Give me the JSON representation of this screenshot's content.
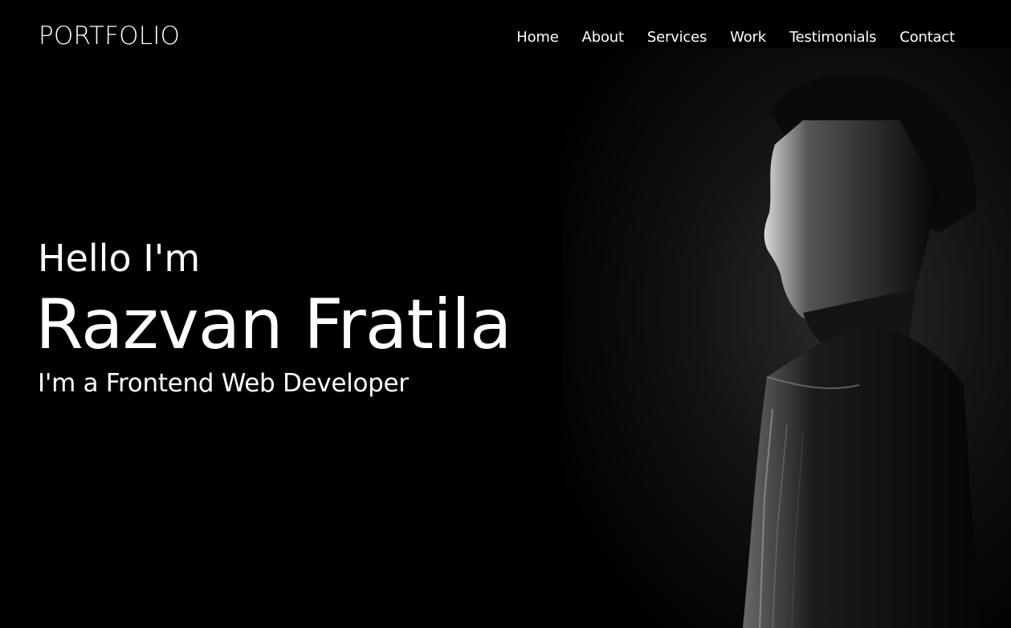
{
  "brand": {
    "logo": "PORTFOLIO"
  },
  "nav": {
    "items": [
      {
        "label": "Home"
      },
      {
        "label": "About"
      },
      {
        "label": "Services"
      },
      {
        "label": "Work"
      },
      {
        "label": "Testimonials"
      },
      {
        "label": "Contact"
      }
    ]
  },
  "hero": {
    "greeting": "Hello I'm",
    "name": "Razvan Fratila",
    "role": "I'm a Frontend Web Developer"
  },
  "colors": {
    "background": "#000000",
    "text": "#ffffff"
  },
  "icons": {
    "portrait": "person-silhouette-photo"
  }
}
